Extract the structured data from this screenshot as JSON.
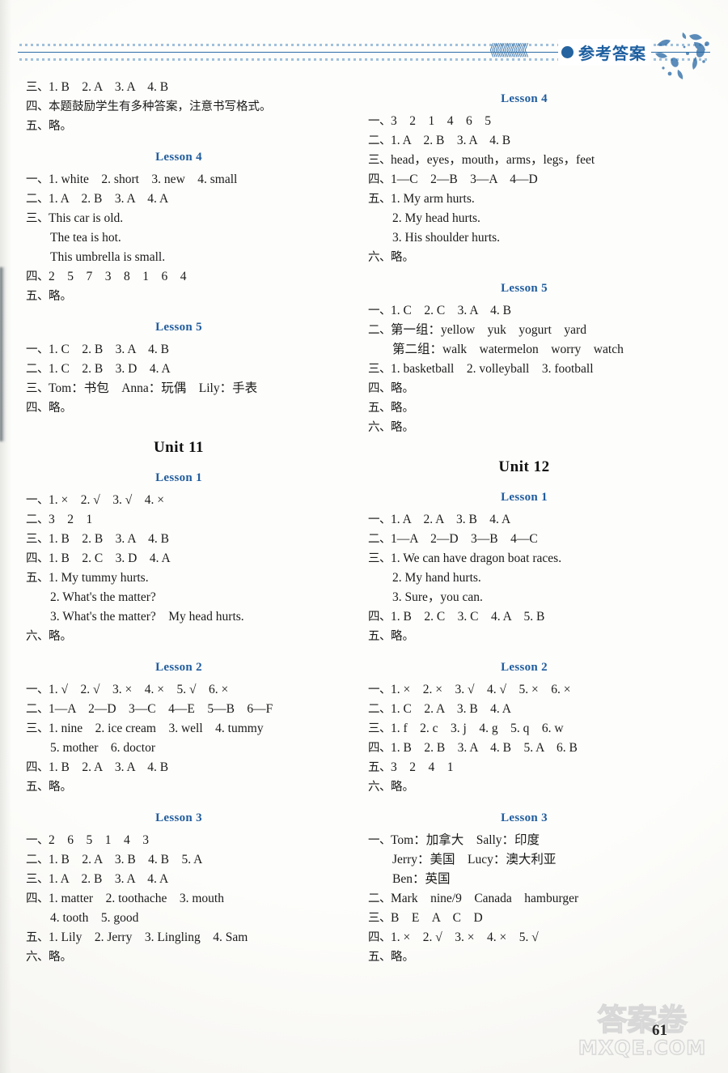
{
  "header": {
    "title": "参考答案",
    "chevrons": "《《《《《《《《《《"
  },
  "footer": {
    "page_number": "61",
    "watermark_cjk": "答案卷",
    "watermark_site": "MXQE.COM"
  },
  "left_column": {
    "blocks": [
      {
        "type": "answers",
        "lines": [
          {
            "num": "三、",
            "body": "1. B　2. A　3. A　4. B"
          },
          {
            "num": "四、",
            "body": "本题鼓励学生有多种答案，注意书写格式。",
            "cjk": true
          },
          {
            "num": "五、",
            "body": "略。",
            "cjk": true
          }
        ]
      },
      {
        "type": "lesson",
        "heading": "Lesson 4",
        "lines": [
          {
            "num": "一、",
            "body": "1. white　2. short　3. new　4. small"
          },
          {
            "num": "二、",
            "body": "1. A　2. B　3. A　4. A"
          },
          {
            "num": "三、",
            "body": "This car is old."
          },
          {
            "cont": "The tea is hot."
          },
          {
            "cont": "This umbrella is small."
          },
          {
            "num": "四、",
            "body": "2　5　7　3　8　1　6　4"
          },
          {
            "num": "五、",
            "body": "略。",
            "cjk": true
          }
        ]
      },
      {
        "type": "lesson",
        "heading": "Lesson 5",
        "lines": [
          {
            "num": "一、",
            "body": "1. C　2. B　3. A　4. B"
          },
          {
            "num": "二、",
            "body": "1. C　2. B　3. D　4. A"
          },
          {
            "num": "三、",
            "body": "Tom：书包　Anna：玩偶　Lily：手表"
          },
          {
            "num": "四、",
            "body": "略。",
            "cjk": true
          }
        ]
      },
      {
        "type": "unit",
        "heading": "Unit 11"
      },
      {
        "type": "lesson",
        "heading": "Lesson 1",
        "lines": [
          {
            "num": "一、",
            "body": "1. ×　2. √　3. √　4. ×"
          },
          {
            "num": "二、",
            "body": "3　2　1"
          },
          {
            "num": "三、",
            "body": "1. B　2. B　3. A　4. B"
          },
          {
            "num": "四、",
            "body": "1. B　2. C　3. D　4. A"
          },
          {
            "num": "五、",
            "body": "1. My tummy hurts."
          },
          {
            "cont": "2. What's the matter?"
          },
          {
            "cont": "3. What's the matter?　My head hurts."
          },
          {
            "num": "六、",
            "body": "略。",
            "cjk": true
          }
        ]
      },
      {
        "type": "lesson",
        "heading": "Lesson 2",
        "lines": [
          {
            "num": "一、",
            "body": "1. √　2. √　3. ×　4. ×　5. √　6. ×"
          },
          {
            "num": "二、",
            "body": "1—A　2—D　3—C　4—E　5—B　6—F"
          },
          {
            "num": "三、",
            "body": "1. nine　2. ice cream　3. well　4. tummy"
          },
          {
            "cont": "5. mother　6. doctor"
          },
          {
            "num": "四、",
            "body": "1. B　2. A　3. A　4. B"
          },
          {
            "num": "五、",
            "body": "略。",
            "cjk": true
          }
        ]
      },
      {
        "type": "lesson",
        "heading": "Lesson 3",
        "lines": [
          {
            "num": "一、",
            "body": "2　6　5　1　4　3"
          },
          {
            "num": "二、",
            "body": "1. B　2. A　3. B　4. B　5. A"
          },
          {
            "num": "三、",
            "body": "1. A　2. B　3. A　4. A"
          },
          {
            "num": "四、",
            "body": "1. matter　2. toothache　3. mouth"
          },
          {
            "cont": "4. tooth　5. good"
          },
          {
            "num": "五、",
            "body": "1. Lily　2. Jerry　3. Lingling　4. Sam"
          },
          {
            "num": "六、",
            "body": "略。",
            "cjk": true
          }
        ]
      }
    ]
  },
  "right_column": {
    "blocks": [
      {
        "type": "lesson",
        "heading": "Lesson 4",
        "lines": [
          {
            "num": "一、",
            "body": "3　2　1　4　6　5"
          },
          {
            "num": "二、",
            "body": "1. A　2. B　3. A　4. B"
          },
          {
            "num": "三、",
            "body": "head，eyes，mouth，arms，legs，feet"
          },
          {
            "num": "四、",
            "body": "1—C　2—B　3—A　4—D"
          },
          {
            "num": "五、",
            "body": "1. My arm hurts."
          },
          {
            "cont": "2. My head hurts."
          },
          {
            "cont": "3. His shoulder hurts."
          },
          {
            "num": "六、",
            "body": "略。",
            "cjk": true
          }
        ]
      },
      {
        "type": "lesson",
        "heading": "Lesson 5",
        "lines": [
          {
            "num": "一、",
            "body": "1. C　2. C　3. A　4. B"
          },
          {
            "num": "二、",
            "body": "第一组：yellow　yuk　yogurt　yard"
          },
          {
            "cont": "第二组：walk　watermelon　worry　watch"
          },
          {
            "num": "三、",
            "body": "1. basketball　2. volleyball　3. football"
          },
          {
            "num": "四、",
            "body": "略。",
            "cjk": true
          },
          {
            "num": "五、",
            "body": "略。",
            "cjk": true
          },
          {
            "num": "六、",
            "body": "略。",
            "cjk": true
          }
        ]
      },
      {
        "type": "unit",
        "heading": "Unit 12"
      },
      {
        "type": "lesson",
        "heading": "Lesson 1",
        "lines": [
          {
            "num": "一、",
            "body": "1. A　2. A　3. B　4. A"
          },
          {
            "num": "二、",
            "body": "1—A　2—D　3—B　4—C"
          },
          {
            "num": "三、",
            "body": "1. We can have dragon boat races."
          },
          {
            "cont": "2. My hand hurts."
          },
          {
            "cont": "3. Sure，you can."
          },
          {
            "num": "四、",
            "body": "1. B　2. C　3. C　4. A　5. B"
          },
          {
            "num": "五、",
            "body": "略。",
            "cjk": true
          }
        ]
      },
      {
        "type": "lesson",
        "heading": "Lesson 2",
        "lines": [
          {
            "num": "一、",
            "body": "1. ×　2. ×　3. √　4. √　5. ×　6. ×"
          },
          {
            "num": "二、",
            "body": "1. C　2. A　3. B　4. A"
          },
          {
            "num": "三、",
            "body": "1. f　2. c　3. j　4. g　5. q　6. w"
          },
          {
            "num": "四、",
            "body": "1. B　2. B　3. A　4. B　5. A　6. B"
          },
          {
            "num": "五、",
            "body": "3　2　4　1"
          },
          {
            "num": "六、",
            "body": "略。",
            "cjk": true
          }
        ]
      },
      {
        "type": "lesson",
        "heading": "Lesson 3",
        "lines": [
          {
            "num": "一、",
            "body": "Tom：加拿大　Sally：印度"
          },
          {
            "cont": "Jerry：美国　Lucy：澳大利亚"
          },
          {
            "cont": "Ben：英国"
          },
          {
            "num": "二、",
            "body": "Mark　nine/9　Canada　hamburger"
          },
          {
            "num": "三、",
            "body": "B　E　A　C　D"
          },
          {
            "num": "四、",
            "body": "1. ×　2. √　3. ×　4. ×　5. √"
          },
          {
            "num": "五、",
            "body": "略。",
            "cjk": true
          }
        ]
      }
    ]
  }
}
